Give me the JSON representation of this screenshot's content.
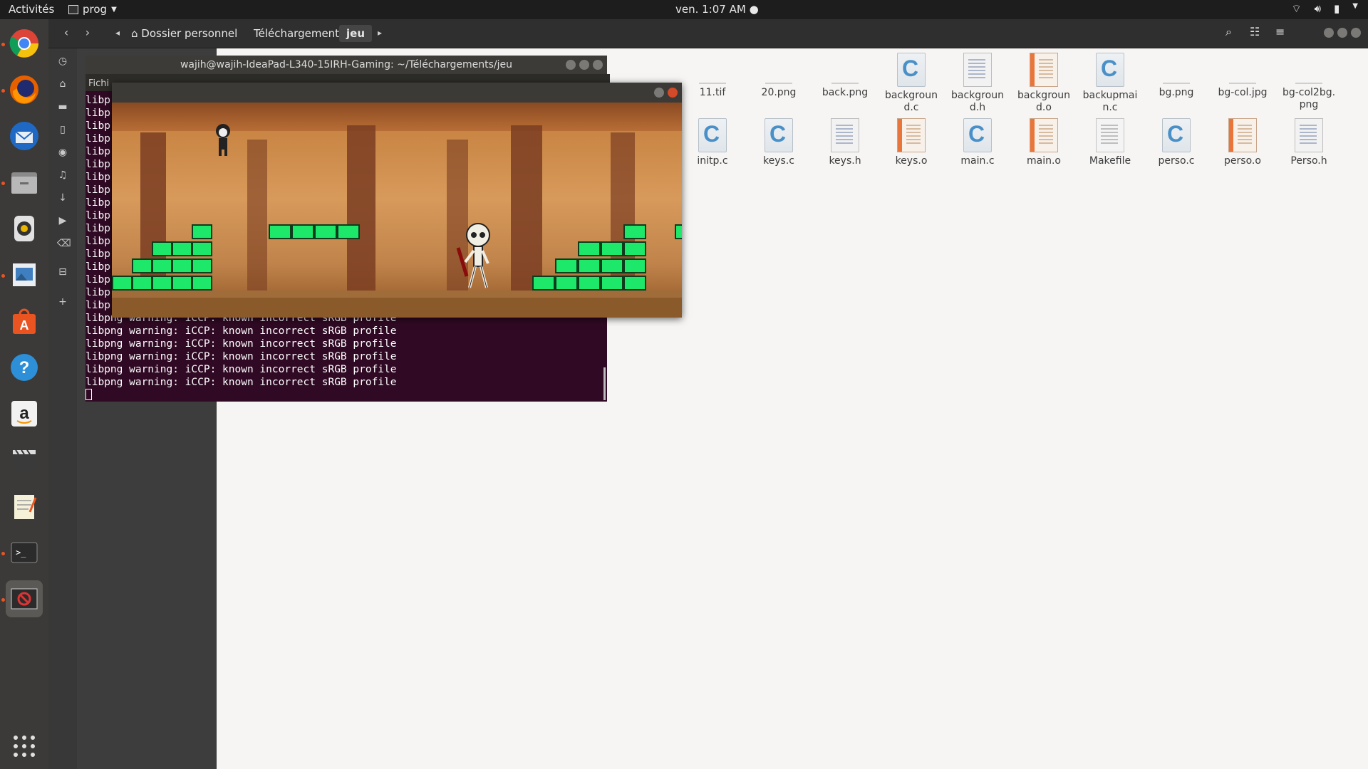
{
  "topbar": {
    "activities": "Activités",
    "app_name": "prog",
    "clock": "ven.  1:07 AM",
    "tray_icons": [
      "wifi-icon",
      "volume-icon",
      "battery-icon",
      "power-menu-icon"
    ]
  },
  "dock": {
    "items": [
      "chrome-icon",
      "firefox-icon",
      "thunderbird-icon",
      "files-icon",
      "rhythmbox-icon",
      "image-viewer-icon",
      "software-center-icon",
      "help-icon",
      "amazon-icon",
      "video-editor-icon",
      "text-editor-icon",
      "terminal-icon",
      "game-window-icon"
    ],
    "apps_grid_icon": "show-applications-icon"
  },
  "file_manager": {
    "breadcrumbs": [
      "Dossier personnel",
      "Téléchargements",
      "jeu"
    ],
    "active_crumb": "jeu",
    "files_row1": [
      "11.tif",
      "20.png",
      "back.png",
      "backgroun d.c",
      "backgroun d.h",
      "backgroun d.o",
      "backupmai n.c",
      "bg.png",
      "bg-col.jpg",
      "bg-col2bg. png"
    ],
    "files_row2": [
      "initp.c",
      "keys.c",
      "keys.h",
      "keys.o",
      "main.c",
      "main.o",
      "Makefile",
      "perso.c",
      "perso.o",
      "Perso.h"
    ]
  },
  "terminal": {
    "title": "wajih@wajih-IdeaPad-L340-15IRH-Gaming: ~/Téléchargements/jeu",
    "menu": "Fichi",
    "short_lines": [
      "libp",
      "libp",
      "libp",
      "libp",
      "libp",
      "libp",
      "libp",
      "libp",
      "libp",
      "libp",
      "libp",
      "libp",
      "libp",
      "libp",
      "libp",
      "libp",
      "libp"
    ],
    "full_lines": [
      "libpng warning: iCCP: known incorrect sRGB profile",
      "libpng warning: iCCP: known incorrect sRGB profile",
      "libpng warning: iCCP: known incorrect sRGB profile",
      "libpng warning: iCCP: known incorrect sRGB profile",
      "libpng warning: iCCP: known incorrect sRGB profile",
      "libpng warning: iCCP: known incorrect sRGB profile"
    ]
  },
  "game_window": {
    "blocks_color": "#1ee86a"
  },
  "colors": {
    "accent": "#e95420",
    "terminal_bg": "#300a24"
  }
}
